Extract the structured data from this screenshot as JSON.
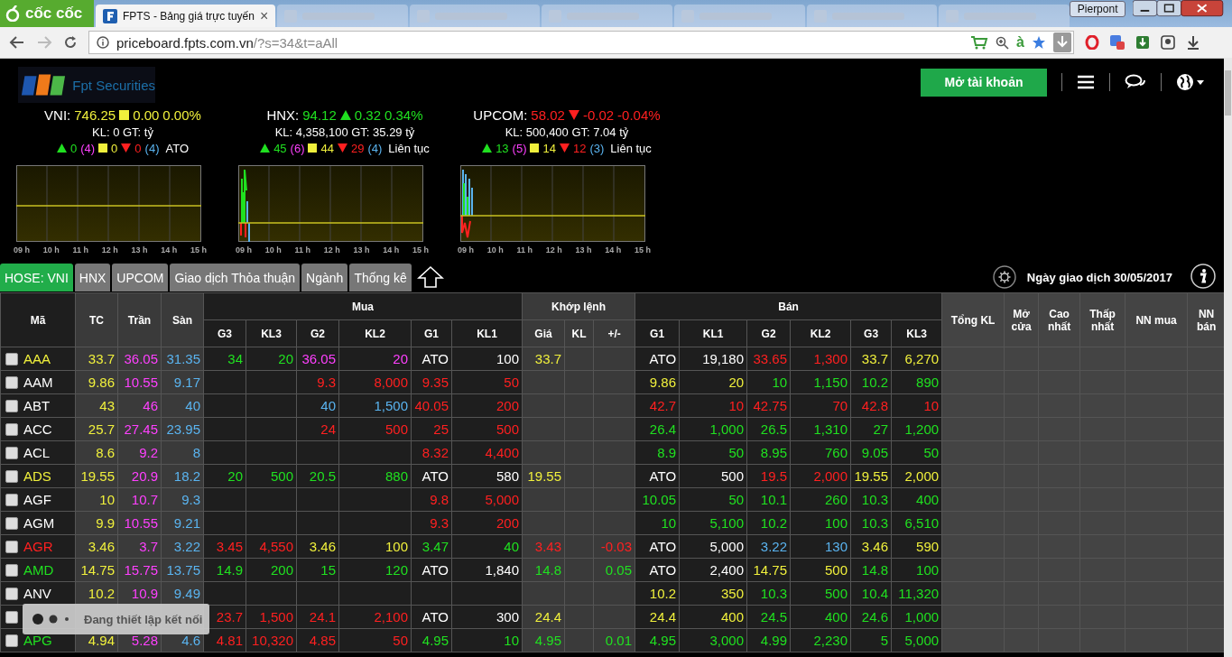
{
  "browser": {
    "brand": "cốc cốc",
    "active_tab": {
      "title": "FPTS - Bảng giá trực tuyến",
      "close": "×"
    },
    "profile": "Pierpont",
    "url_host": "priceboard.fpts.com.vn",
    "url_path": "/?s=34&t=aAll",
    "toolbar_glyph": "à"
  },
  "header": {
    "logo_text": "Fpt Securities",
    "open_account": "Mở tài khoản"
  },
  "indices": [
    {
      "name": "VNI:",
      "value": "746.25",
      "kind": "flat",
      "change": "0.00",
      "percent": "0.00%",
      "volume_line": "KL: 0 GT:  tỷ",
      "up": "0",
      "ceiling": "(4)",
      "flat": "0",
      "down": "0",
      "floor": "(4)",
      "session": "ATO",
      "hours": [
        "09 h",
        "10 h",
        "11 h",
        "12 h",
        "13 h",
        "14 h",
        "15 h"
      ]
    },
    {
      "name": "HNX:",
      "value": "94.12",
      "kind": "up",
      "change": "0.32",
      "percent": "0.34%",
      "volume_line": "KL: 4,358,100 GT: 35.29 tỷ",
      "up": "45",
      "ceiling": "(6)",
      "flat": "44",
      "down": "29",
      "floor": "(4)",
      "session": "Liên tục",
      "hours": [
        "09 h",
        "10 h",
        "11 h",
        "12 h",
        "13 h",
        "14 h",
        "15 h"
      ]
    },
    {
      "name": "UPCOM:",
      "value": "58.02",
      "kind": "down",
      "change": "-0.02",
      "percent": "-0.04%",
      "volume_line": "KL: 500,400 GT: 7.04 tỷ",
      "up": "13",
      "ceiling": "(5)",
      "flat": "14",
      "down": "12",
      "floor": "(3)",
      "session": "Liên tục",
      "hours": [
        "09 h",
        "10 h",
        "11 h",
        "12 h",
        "13 h",
        "14 h",
        "15 h"
      ]
    }
  ],
  "tabs": [
    {
      "label": "HOSE: VNI",
      "selected": true
    },
    {
      "label": "HNX",
      "selected": false
    },
    {
      "label": "UPCOM",
      "selected": false
    },
    {
      "label": "Giao dịch Thỏa thuận",
      "selected": false
    },
    {
      "label": "Ngành",
      "selected": false
    },
    {
      "label": "Thống kê",
      "selected": false
    }
  ],
  "trade_date": "Ngày giao dịch 30/05/2017",
  "table": {
    "groups": [
      {
        "label": "Mã"
      },
      {
        "label": "TC"
      },
      {
        "label": "Trần"
      },
      {
        "label": "Sàn"
      },
      {
        "label": "Mua",
        "columns": [
          "G3",
          "KL3",
          "G2",
          "KL2",
          "G1",
          "KL1"
        ]
      },
      {
        "label": "Khớp lệnh",
        "columns": [
          "Giá",
          "KL",
          "+/-"
        ]
      },
      {
        "label": "Bán",
        "columns": [
          "G1",
          "KL1",
          "G2",
          "KL2",
          "G3",
          "KL3"
        ]
      },
      {
        "label": "Tổng KL"
      },
      {
        "label": "Mở cửa"
      },
      {
        "label": "Cao nhất"
      },
      {
        "label": "Thấp nhất"
      },
      {
        "label": "NN mua"
      },
      {
        "label": "NN bán"
      }
    ],
    "rows": [
      {
        "checked": false,
        "symbol": {
          "text": "AAA",
          "color": "#f0f03c"
        },
        "cells": [
          {
            "text": "33.7",
            "color": "#f0f03c"
          },
          {
            "text": "36.05",
            "color": "#ff40ff"
          },
          {
            "text": "31.35",
            "color": "#5ab4f0"
          },
          {
            "text": "34",
            "color": "#20e020"
          },
          {
            "text": "20",
            "color": "#20e020"
          },
          {
            "text": "36.05",
            "color": "#ff40ff"
          },
          {
            "text": "20",
            "color": "#ff40ff"
          },
          {
            "text": "ATO",
            "color": "#ffffff"
          },
          {
            "text": "100",
            "color": "#ffffff"
          },
          {
            "text": "33.7",
            "color": "#f0f03c"
          },
          null,
          null,
          {
            "text": "ATO",
            "color": "#ffffff"
          },
          {
            "text": "19,180",
            "color": "#ffffff"
          },
          {
            "text": "33.65",
            "color": "#ff2020"
          },
          {
            "text": "1,300",
            "color": "#ff2020"
          },
          {
            "text": "33.7",
            "color": "#f0f03c"
          },
          {
            "text": "6,270",
            "color": "#f0f03c"
          }
        ]
      },
      {
        "checked": false,
        "symbol": {
          "text": "AAM",
          "color": "#ffffff"
        },
        "cells": [
          {
            "text": "9.86",
            "color": "#f0f03c"
          },
          {
            "text": "10.55",
            "color": "#ff40ff"
          },
          {
            "text": "9.17",
            "color": "#5ab4f0"
          },
          null,
          null,
          {
            "text": "9.3",
            "color": "#ff2020"
          },
          {
            "text": "8,000",
            "color": "#ff2020"
          },
          {
            "text": "9.35",
            "color": "#ff2020"
          },
          {
            "text": "50",
            "color": "#ff2020"
          },
          null,
          null,
          null,
          {
            "text": "9.86",
            "color": "#f0f03c"
          },
          {
            "text": "20",
            "color": "#f0f03c"
          },
          {
            "text": "10",
            "color": "#20e020"
          },
          {
            "text": "1,150",
            "color": "#20e020"
          },
          {
            "text": "10.2",
            "color": "#20e020"
          },
          {
            "text": "890",
            "color": "#20e020"
          }
        ]
      },
      {
        "checked": false,
        "symbol": {
          "text": "ABT",
          "color": "#ffffff"
        },
        "cells": [
          {
            "text": "43",
            "color": "#f0f03c"
          },
          {
            "text": "46",
            "color": "#ff40ff"
          },
          {
            "text": "40",
            "color": "#5ab4f0"
          },
          null,
          null,
          {
            "text": "40",
            "color": "#5ab4f0"
          },
          {
            "text": "1,500",
            "color": "#5ab4f0"
          },
          {
            "text": "40.05",
            "color": "#ff2020"
          },
          {
            "text": "200",
            "color": "#ff2020"
          },
          null,
          null,
          null,
          {
            "text": "42.7",
            "color": "#ff2020"
          },
          {
            "text": "10",
            "color": "#ff2020"
          },
          {
            "text": "42.75",
            "color": "#ff2020"
          },
          {
            "text": "70",
            "color": "#ff2020"
          },
          {
            "text": "42.8",
            "color": "#ff2020"
          },
          {
            "text": "10",
            "color": "#ff2020"
          }
        ]
      },
      {
        "checked": false,
        "symbol": {
          "text": "ACC",
          "color": "#ffffff"
        },
        "cells": [
          {
            "text": "25.7",
            "color": "#f0f03c"
          },
          {
            "text": "27.45",
            "color": "#ff40ff"
          },
          {
            "text": "23.95",
            "color": "#5ab4f0"
          },
          null,
          null,
          {
            "text": "24",
            "color": "#ff2020"
          },
          {
            "text": "500",
            "color": "#ff2020"
          },
          {
            "text": "25",
            "color": "#ff2020"
          },
          {
            "text": "500",
            "color": "#ff2020"
          },
          null,
          null,
          null,
          {
            "text": "26.4",
            "color": "#20e020"
          },
          {
            "text": "1,000",
            "color": "#20e020"
          },
          {
            "text": "26.5",
            "color": "#20e020"
          },
          {
            "text": "1,310",
            "color": "#20e020"
          },
          {
            "text": "27",
            "color": "#20e020"
          },
          {
            "text": "1,200",
            "color": "#20e020"
          }
        ]
      },
      {
        "checked": false,
        "symbol": {
          "text": "ACL",
          "color": "#ffffff"
        },
        "cells": [
          {
            "text": "8.6",
            "color": "#f0f03c"
          },
          {
            "text": "9.2",
            "color": "#ff40ff"
          },
          {
            "text": "8",
            "color": "#5ab4f0"
          },
          null,
          null,
          null,
          null,
          {
            "text": "8.32",
            "color": "#ff2020"
          },
          {
            "text": "4,400",
            "color": "#ff2020"
          },
          null,
          null,
          null,
          {
            "text": "8.9",
            "color": "#20e020"
          },
          {
            "text": "50",
            "color": "#20e020"
          },
          {
            "text": "8.95",
            "color": "#20e020"
          },
          {
            "text": "760",
            "color": "#20e020"
          },
          {
            "text": "9.05",
            "color": "#20e020"
          },
          {
            "text": "50",
            "color": "#20e020"
          }
        ]
      },
      {
        "checked": false,
        "symbol": {
          "text": "ADS",
          "color": "#f0f03c"
        },
        "cells": [
          {
            "text": "19.55",
            "color": "#f0f03c"
          },
          {
            "text": "20.9",
            "color": "#ff40ff"
          },
          {
            "text": "18.2",
            "color": "#5ab4f0"
          },
          {
            "text": "20",
            "color": "#20e020"
          },
          {
            "text": "500",
            "color": "#20e020"
          },
          {
            "text": "20.5",
            "color": "#20e020"
          },
          {
            "text": "880",
            "color": "#20e020"
          },
          {
            "text": "ATO",
            "color": "#ffffff"
          },
          {
            "text": "580",
            "color": "#ffffff"
          },
          {
            "text": "19.55",
            "color": "#f0f03c"
          },
          null,
          null,
          {
            "text": "ATO",
            "color": "#ffffff"
          },
          {
            "text": "500",
            "color": "#ffffff"
          },
          {
            "text": "19.5",
            "color": "#ff2020"
          },
          {
            "text": "2,000",
            "color": "#ff2020"
          },
          {
            "text": "19.55",
            "color": "#f0f03c"
          },
          {
            "text": "2,000",
            "color": "#f0f03c"
          }
        ]
      },
      {
        "checked": false,
        "symbol": {
          "text": "AGF",
          "color": "#ffffff"
        },
        "cells": [
          {
            "text": "10",
            "color": "#f0f03c"
          },
          {
            "text": "10.7",
            "color": "#ff40ff"
          },
          {
            "text": "9.3",
            "color": "#5ab4f0"
          },
          null,
          null,
          null,
          null,
          {
            "text": "9.8",
            "color": "#ff2020"
          },
          {
            "text": "5,000",
            "color": "#ff2020"
          },
          null,
          null,
          null,
          {
            "text": "10.05",
            "color": "#20e020"
          },
          {
            "text": "50",
            "color": "#20e020"
          },
          {
            "text": "10.1",
            "color": "#20e020"
          },
          {
            "text": "260",
            "color": "#20e020"
          },
          {
            "text": "10.3",
            "color": "#20e020"
          },
          {
            "text": "400",
            "color": "#20e020"
          }
        ]
      },
      {
        "checked": false,
        "symbol": {
          "text": "AGM",
          "color": "#ffffff"
        },
        "cells": [
          {
            "text": "9.9",
            "color": "#f0f03c"
          },
          {
            "text": "10.55",
            "color": "#ff40ff"
          },
          {
            "text": "9.21",
            "color": "#5ab4f0"
          },
          null,
          null,
          null,
          null,
          {
            "text": "9.3",
            "color": "#ff2020"
          },
          {
            "text": "200",
            "color": "#ff2020"
          },
          null,
          null,
          null,
          {
            "text": "10",
            "color": "#20e020"
          },
          {
            "text": "5,100",
            "color": "#20e020"
          },
          {
            "text": "10.2",
            "color": "#20e020"
          },
          {
            "text": "100",
            "color": "#20e020"
          },
          {
            "text": "10.3",
            "color": "#20e020"
          },
          {
            "text": "6,510",
            "color": "#20e020"
          }
        ]
      },
      {
        "checked": false,
        "symbol": {
          "text": "AGR",
          "color": "#ff2020"
        },
        "cells": [
          {
            "text": "3.46",
            "color": "#f0f03c"
          },
          {
            "text": "3.7",
            "color": "#ff40ff"
          },
          {
            "text": "3.22",
            "color": "#5ab4f0"
          },
          {
            "text": "3.45",
            "color": "#ff2020"
          },
          {
            "text": "4,550",
            "color": "#ff2020"
          },
          {
            "text": "3.46",
            "color": "#f0f03c"
          },
          {
            "text": "100",
            "color": "#f0f03c"
          },
          {
            "text": "3.47",
            "color": "#20e020"
          },
          {
            "text": "40",
            "color": "#20e020"
          },
          {
            "text": "3.43",
            "color": "#ff2020"
          },
          null,
          {
            "text": "-0.03",
            "color": "#ff2020"
          },
          {
            "text": "ATO",
            "color": "#ffffff"
          },
          {
            "text": "5,000",
            "color": "#ffffff"
          },
          {
            "text": "3.22",
            "color": "#5ab4f0"
          },
          {
            "text": "130",
            "color": "#5ab4f0"
          },
          {
            "text": "3.46",
            "color": "#f0f03c"
          },
          {
            "text": "590",
            "color": "#f0f03c"
          }
        ]
      },
      {
        "checked": false,
        "symbol": {
          "text": "AMD",
          "color": "#20e020"
        },
        "cells": [
          {
            "text": "14.75",
            "color": "#f0f03c"
          },
          {
            "text": "15.75",
            "color": "#ff40ff"
          },
          {
            "text": "13.75",
            "color": "#5ab4f0"
          },
          {
            "text": "14.9",
            "color": "#20e020"
          },
          {
            "text": "200",
            "color": "#20e020"
          },
          {
            "text": "15",
            "color": "#20e020"
          },
          {
            "text": "120",
            "color": "#20e020"
          },
          {
            "text": "ATO",
            "color": "#ffffff"
          },
          {
            "text": "1,840",
            "color": "#ffffff"
          },
          {
            "text": "14.8",
            "color": "#20e020"
          },
          null,
          {
            "text": "0.05",
            "color": "#20e020"
          },
          {
            "text": "ATO",
            "color": "#ffffff"
          },
          {
            "text": "2,400",
            "color": "#ffffff"
          },
          {
            "text": "14.75",
            "color": "#f0f03c"
          },
          {
            "text": "500",
            "color": "#f0f03c"
          },
          {
            "text": "14.8",
            "color": "#20e020"
          },
          {
            "text": "100",
            "color": "#20e020"
          }
        ]
      },
      {
        "checked": false,
        "symbol": {
          "text": "ANV",
          "color": "#ffffff"
        },
        "cells": [
          {
            "text": "10.2",
            "color": "#f0f03c"
          },
          {
            "text": "10.9",
            "color": "#ff40ff"
          },
          {
            "text": "9.49",
            "color": "#5ab4f0"
          },
          null,
          null,
          null,
          null,
          null,
          null,
          null,
          null,
          null,
          {
            "text": "10.2",
            "color": "#f0f03c"
          },
          {
            "text": "350",
            "color": "#f0f03c"
          },
          {
            "text": "10.3",
            "color": "#20e020"
          },
          {
            "text": "500",
            "color": "#20e020"
          },
          {
            "text": "10.4",
            "color": "#20e020"
          },
          {
            "text": "11,320",
            "color": "#20e020"
          }
        ]
      },
      {
        "checked": false,
        "symbol": null,
        "cells": [
          null,
          null,
          null,
          {
            "text": "23.7",
            "color": "#ff2020"
          },
          {
            "text": "1,500",
            "color": "#ff2020"
          },
          {
            "text": "24.1",
            "color": "#ff2020"
          },
          {
            "text": "2,100",
            "color": "#ff2020"
          },
          {
            "text": "ATO",
            "color": "#ffffff"
          },
          {
            "text": "300",
            "color": "#ffffff"
          },
          {
            "text": "24.4",
            "color": "#f0f03c"
          },
          null,
          null,
          {
            "text": "24.4",
            "color": "#f0f03c"
          },
          {
            "text": "400",
            "color": "#f0f03c"
          },
          {
            "text": "24.5",
            "color": "#20e020"
          },
          {
            "text": "400",
            "color": "#20e020"
          },
          {
            "text": "24.6",
            "color": "#20e020"
          },
          {
            "text": "1,000",
            "color": "#20e020"
          }
        ]
      },
      {
        "checked": false,
        "symbol": {
          "text": "APG",
          "color": "#20e020"
        },
        "cells": [
          {
            "text": "4.94",
            "color": "#f0f03c"
          },
          {
            "text": "5.28",
            "color": "#ff40ff"
          },
          {
            "text": "4.6",
            "color": "#5ab4f0"
          },
          {
            "text": "4.81",
            "color": "#ff2020"
          },
          {
            "text": "10,320",
            "color": "#ff2020"
          },
          {
            "text": "4.85",
            "color": "#ff2020"
          },
          {
            "text": "50",
            "color": "#ff2020"
          },
          {
            "text": "4.95",
            "color": "#20e020"
          },
          {
            "text": "10",
            "color": "#20e020"
          },
          {
            "text": "4.95",
            "color": "#20e020"
          },
          null,
          {
            "text": "0.01",
            "color": "#20e020"
          },
          {
            "text": "4.95",
            "color": "#20e020"
          },
          {
            "text": "3,000",
            "color": "#20e020"
          },
          {
            "text": "4.99",
            "color": "#20e020"
          },
          {
            "text": "2,230",
            "color": "#20e020"
          },
          {
            "text": "5",
            "color": "#20e020"
          },
          {
            "text": "5,000",
            "color": "#20e020"
          }
        ]
      }
    ]
  },
  "toast": "Đang thiết lập kết nối"
}
